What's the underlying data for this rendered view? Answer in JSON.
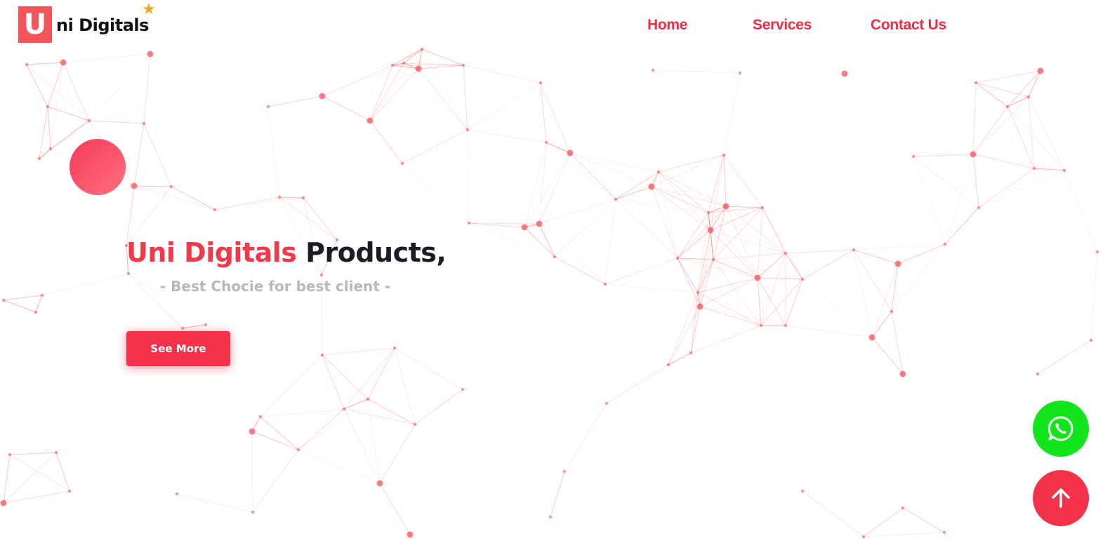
{
  "header": {
    "logo_letter": "U",
    "logo_text": "ni Digitals",
    "logo_star_icon": "star-icon",
    "nav": [
      {
        "label": "Home"
      },
      {
        "label": "Services"
      },
      {
        "label": "Contact Us"
      }
    ]
  },
  "hero": {
    "title_brand": "Uni Digitals",
    "title_rest": " Products,",
    "subtitle": "- Best Chocie for best client -",
    "cta_label": "See More"
  },
  "floating": {
    "whatsapp_icon": "whatsapp-icon",
    "scroll_top_icon": "arrow-up-icon"
  },
  "colors": {
    "accent": "#f4334a",
    "network": "#f4545a",
    "whatsapp": "#12e51c",
    "subtitle": "#b8b8b8"
  }
}
